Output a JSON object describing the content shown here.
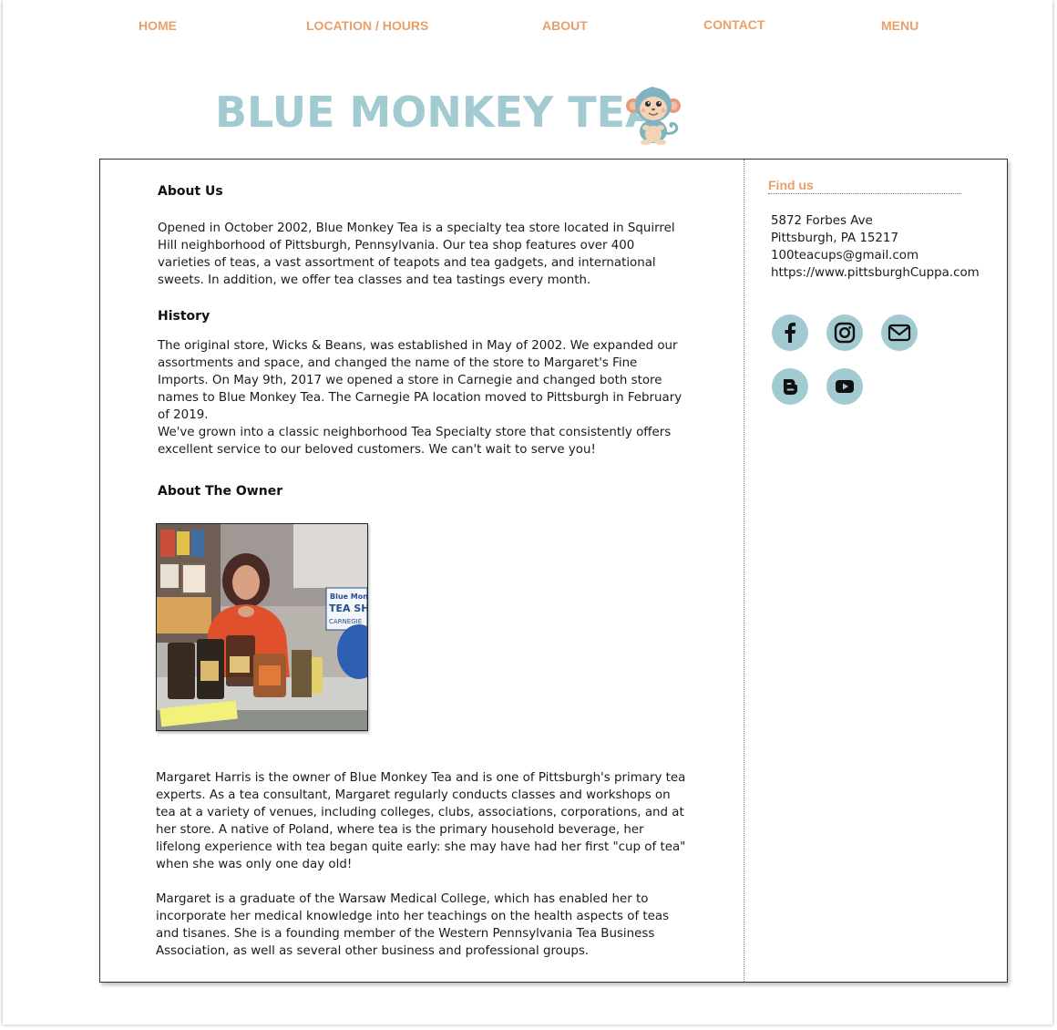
{
  "nav": {
    "home": "HOME",
    "location_hours": "LOCATION / HOURS",
    "about": "ABOUT",
    "contact": "CONTACT",
    "menu": "MENU"
  },
  "site": {
    "title": "BLUE MONKEY TEA"
  },
  "main": {
    "about_heading": "About Us",
    "about_text": "Opened in October 2002, Blue Monkey Tea is a specialty tea store located in Squirrel Hill neighborhood of Pittsburgh, Pennsylvania. Our tea shop features over 400 varieties of teas, a vast assortment of teapots and tea gadgets, and international sweets. In addition, we offer tea classes and tea tastings every month.",
    "history_heading": "History",
    "history_text": "The original store, Wicks & Beans, was established in May of 2002. We expanded our assortments and space, and changed the name of the store to Margaret's Fine Imports. On May 9th, 2017 we opened a store in Carnegie and changed both store names to Blue Monkey Tea. The Carnegie PA location moved to Pittsburgh in February of 2019.",
    "history_text_2": "We've grown into a classic neighborhood Tea Specialty store that consistently offers excellent service to our beloved customers. We can't wait to serve you!",
    "owner_heading": "About The Owner",
    "photo_sign": "Blue Monkey TEA SHOP CARNEGIE",
    "owner_text": "Margaret Harris is the owner of Blue Monkey Tea and is one of Pittsburgh's primary tea experts. As a tea consultant, Margaret  regularly conducts classes and workshops on tea at a variety of venues, including colleges, clubs, associations, corporations, and at her store. A native of Poland, where tea is the primary household beverage, her lifelong experience with tea began quite early: she may have had her first \"cup of tea\" when she was only one day old!",
    "owner_text_2": "Margaret is a graduate of the Warsaw Medical College, which has enabled her to incorporate her medical knowledge into her teachings on the health aspects of teas and tisanes. She is a founding member of the Western Pennsylvania Tea Business Association, as well as several other business and professional groups."
  },
  "sidebar": {
    "findus": "Find us",
    "address_1": "5872 Forbes Ave",
    "address_2": "Pittsburgh, PA 15217",
    "email": "100teacups@gmail.com",
    "website": "https://www.pittsburghCuppa.com",
    "social_icons": [
      "facebook-icon",
      "instagram-icon",
      "email-icon",
      "blogger-icon",
      "youtube-icon"
    ]
  },
  "colors": {
    "nav": "#e8a06a",
    "title": "#a2cbd1",
    "social_bg": "#a2cbd1"
  }
}
